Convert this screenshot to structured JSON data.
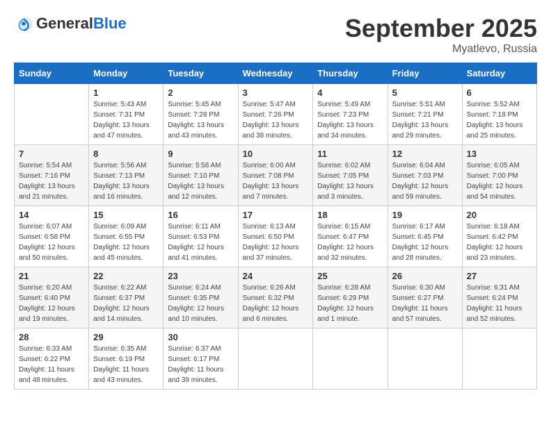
{
  "header": {
    "logo_general": "General",
    "logo_blue": "Blue",
    "month_title": "September 2025",
    "location": "Myatlevo, Russia"
  },
  "weekdays": [
    "Sunday",
    "Monday",
    "Tuesday",
    "Wednesday",
    "Thursday",
    "Friday",
    "Saturday"
  ],
  "weeks": [
    [
      {
        "day": "",
        "sunrise": "",
        "sunset": "",
        "daylight": ""
      },
      {
        "day": "1",
        "sunrise": "Sunrise: 5:43 AM",
        "sunset": "Sunset: 7:31 PM",
        "daylight": "Daylight: 13 hours and 47 minutes."
      },
      {
        "day": "2",
        "sunrise": "Sunrise: 5:45 AM",
        "sunset": "Sunset: 7:28 PM",
        "daylight": "Daylight: 13 hours and 43 minutes."
      },
      {
        "day": "3",
        "sunrise": "Sunrise: 5:47 AM",
        "sunset": "Sunset: 7:26 PM",
        "daylight": "Daylight: 13 hours and 38 minutes."
      },
      {
        "day": "4",
        "sunrise": "Sunrise: 5:49 AM",
        "sunset": "Sunset: 7:23 PM",
        "daylight": "Daylight: 13 hours and 34 minutes."
      },
      {
        "day": "5",
        "sunrise": "Sunrise: 5:51 AM",
        "sunset": "Sunset: 7:21 PM",
        "daylight": "Daylight: 13 hours and 29 minutes."
      },
      {
        "day": "6",
        "sunrise": "Sunrise: 5:52 AM",
        "sunset": "Sunset: 7:18 PM",
        "daylight": "Daylight: 13 hours and 25 minutes."
      }
    ],
    [
      {
        "day": "7",
        "sunrise": "Sunrise: 5:54 AM",
        "sunset": "Sunset: 7:16 PM",
        "daylight": "Daylight: 13 hours and 21 minutes."
      },
      {
        "day": "8",
        "sunrise": "Sunrise: 5:56 AM",
        "sunset": "Sunset: 7:13 PM",
        "daylight": "Daylight: 13 hours and 16 minutes."
      },
      {
        "day": "9",
        "sunrise": "Sunrise: 5:58 AM",
        "sunset": "Sunset: 7:10 PM",
        "daylight": "Daylight: 13 hours and 12 minutes."
      },
      {
        "day": "10",
        "sunrise": "Sunrise: 6:00 AM",
        "sunset": "Sunset: 7:08 PM",
        "daylight": "Daylight: 13 hours and 7 minutes."
      },
      {
        "day": "11",
        "sunrise": "Sunrise: 6:02 AM",
        "sunset": "Sunset: 7:05 PM",
        "daylight": "Daylight: 13 hours and 3 minutes."
      },
      {
        "day": "12",
        "sunrise": "Sunrise: 6:04 AM",
        "sunset": "Sunset: 7:03 PM",
        "daylight": "Daylight: 12 hours and 59 minutes."
      },
      {
        "day": "13",
        "sunrise": "Sunrise: 6:05 AM",
        "sunset": "Sunset: 7:00 PM",
        "daylight": "Daylight: 12 hours and 54 minutes."
      }
    ],
    [
      {
        "day": "14",
        "sunrise": "Sunrise: 6:07 AM",
        "sunset": "Sunset: 6:58 PM",
        "daylight": "Daylight: 12 hours and 50 minutes."
      },
      {
        "day": "15",
        "sunrise": "Sunrise: 6:09 AM",
        "sunset": "Sunset: 6:55 PM",
        "daylight": "Daylight: 12 hours and 45 minutes."
      },
      {
        "day": "16",
        "sunrise": "Sunrise: 6:11 AM",
        "sunset": "Sunset: 6:53 PM",
        "daylight": "Daylight: 12 hours and 41 minutes."
      },
      {
        "day": "17",
        "sunrise": "Sunrise: 6:13 AM",
        "sunset": "Sunset: 6:50 PM",
        "daylight": "Daylight: 12 hours and 37 minutes."
      },
      {
        "day": "18",
        "sunrise": "Sunrise: 6:15 AM",
        "sunset": "Sunset: 6:47 PM",
        "daylight": "Daylight: 12 hours and 32 minutes."
      },
      {
        "day": "19",
        "sunrise": "Sunrise: 6:17 AM",
        "sunset": "Sunset: 6:45 PM",
        "daylight": "Daylight: 12 hours and 28 minutes."
      },
      {
        "day": "20",
        "sunrise": "Sunrise: 6:18 AM",
        "sunset": "Sunset: 6:42 PM",
        "daylight": "Daylight: 12 hours and 23 minutes."
      }
    ],
    [
      {
        "day": "21",
        "sunrise": "Sunrise: 6:20 AM",
        "sunset": "Sunset: 6:40 PM",
        "daylight": "Daylight: 12 hours and 19 minutes."
      },
      {
        "day": "22",
        "sunrise": "Sunrise: 6:22 AM",
        "sunset": "Sunset: 6:37 PM",
        "daylight": "Daylight: 12 hours and 14 minutes."
      },
      {
        "day": "23",
        "sunrise": "Sunrise: 6:24 AM",
        "sunset": "Sunset: 6:35 PM",
        "daylight": "Daylight: 12 hours and 10 minutes."
      },
      {
        "day": "24",
        "sunrise": "Sunrise: 6:26 AM",
        "sunset": "Sunset: 6:32 PM",
        "daylight": "Daylight: 12 hours and 6 minutes."
      },
      {
        "day": "25",
        "sunrise": "Sunrise: 6:28 AM",
        "sunset": "Sunset: 6:29 PM",
        "daylight": "Daylight: 12 hours and 1 minute."
      },
      {
        "day": "26",
        "sunrise": "Sunrise: 6:30 AM",
        "sunset": "Sunset: 6:27 PM",
        "daylight": "Daylight: 11 hours and 57 minutes."
      },
      {
        "day": "27",
        "sunrise": "Sunrise: 6:31 AM",
        "sunset": "Sunset: 6:24 PM",
        "daylight": "Daylight: 11 hours and 52 minutes."
      }
    ],
    [
      {
        "day": "28",
        "sunrise": "Sunrise: 6:33 AM",
        "sunset": "Sunset: 6:22 PM",
        "daylight": "Daylight: 11 hours and 48 minutes."
      },
      {
        "day": "29",
        "sunrise": "Sunrise: 6:35 AM",
        "sunset": "Sunset: 6:19 PM",
        "daylight": "Daylight: 11 hours and 43 minutes."
      },
      {
        "day": "30",
        "sunrise": "Sunrise: 6:37 AM",
        "sunset": "Sunset: 6:17 PM",
        "daylight": "Daylight: 11 hours and 39 minutes."
      },
      {
        "day": "",
        "sunrise": "",
        "sunset": "",
        "daylight": ""
      },
      {
        "day": "",
        "sunrise": "",
        "sunset": "",
        "daylight": ""
      },
      {
        "day": "",
        "sunrise": "",
        "sunset": "",
        "daylight": ""
      },
      {
        "day": "",
        "sunrise": "",
        "sunset": "",
        "daylight": ""
      }
    ]
  ]
}
